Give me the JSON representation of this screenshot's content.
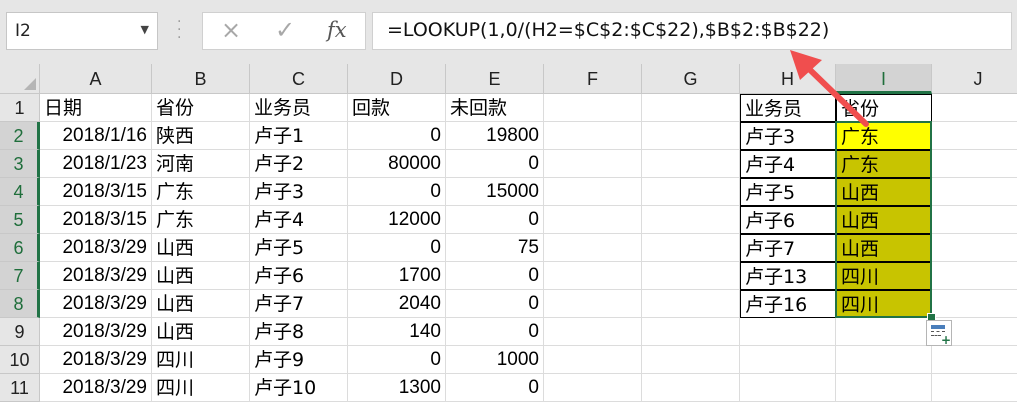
{
  "name_box": {
    "value": "I2"
  },
  "formula_bar": {
    "cancel_icon": "×",
    "enter_icon": "✓",
    "fx_label": "fx",
    "formula": "=LOOKUP(1,0/(H2=$C$2:$C$22),$B$2:$B$22)"
  },
  "columns": [
    "A",
    "B",
    "C",
    "D",
    "E",
    "F",
    "G",
    "H",
    "I",
    "J"
  ],
  "rows": [
    "1",
    "2",
    "3",
    "4",
    "5",
    "6",
    "7",
    "8",
    "9",
    "10",
    "11"
  ],
  "table": {
    "headers": [
      "日期",
      "省份",
      "业务员",
      "回款",
      "未回款"
    ],
    "data": [
      [
        "2018/1/16",
        "陕西",
        "卢子1",
        "0",
        "19800"
      ],
      [
        "2018/1/23",
        "河南",
        "卢子2",
        "80000",
        "0"
      ],
      [
        "2018/3/15",
        "广东",
        "卢子3",
        "0",
        "15000"
      ],
      [
        "2018/3/15",
        "广东",
        "卢子4",
        "12000",
        "0"
      ],
      [
        "2018/3/29",
        "山西",
        "卢子5",
        "0",
        "75"
      ],
      [
        "2018/3/29",
        "山西",
        "卢子6",
        "1700",
        "0"
      ],
      [
        "2018/3/29",
        "山西",
        "卢子7",
        "2040",
        "0"
      ],
      [
        "2018/3/29",
        "山西",
        "卢子8",
        "140",
        "0"
      ],
      [
        "2018/3/29",
        "四川",
        "卢子9",
        "0",
        "1000"
      ],
      [
        "2018/3/29",
        "四川",
        "卢子10",
        "1300",
        "0"
      ]
    ]
  },
  "lookup": {
    "headers": [
      "业务员",
      "省份"
    ],
    "data": [
      [
        "卢子3",
        "广东"
      ],
      [
        "卢子4",
        "广东"
      ],
      [
        "卢子5",
        "山西"
      ],
      [
        "卢子6",
        "山西"
      ],
      [
        "卢子7",
        "山西"
      ],
      [
        "卢子13",
        "四川"
      ],
      [
        "卢子16",
        "四川"
      ]
    ]
  },
  "colors": {
    "active_cell_fill": "#ffff00",
    "selection_fill": "#c8c400",
    "excel_green": "#217346",
    "arrow": "#f04e4e"
  }
}
